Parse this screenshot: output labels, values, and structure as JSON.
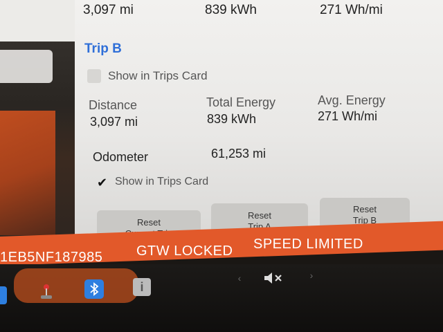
{
  "top_row": {
    "distance": "3,097 mi",
    "energy": "839 kWh",
    "avg": "271 Wh/mi"
  },
  "trip_b": {
    "title": "Trip B",
    "show_in_trips_card": "Show in Trips Card",
    "distance_label": "Distance",
    "distance_value": "3,097 mi",
    "total_energy_label": "Total Energy",
    "total_energy_value": "839 kWh",
    "avg_energy_label": "Avg. Energy",
    "avg_energy_value": "271 Wh/mi"
  },
  "odometer": {
    "label": "Odometer",
    "value": "61,253 mi",
    "show_in_trips_card": "Show in Trips Card",
    "checked": true
  },
  "buttons": {
    "reset_current_line1": "Reset",
    "reset_current_line2": "Current Trip",
    "reset_a_line1": "Reset",
    "reset_a_line2": "Trip A",
    "reset_b_line1": "Reset",
    "reset_b_line2": "Trip B"
  },
  "status_bar": {
    "vin_fragment": "1EB5NF187985",
    "gtw": "GTW LOCKED",
    "speed": "SPEED LIMITED"
  },
  "dock": {
    "icons": [
      "joystick-icon",
      "bluetooth-icon",
      "info-icon",
      "mute-icon"
    ],
    "mute_glyph": "◀×"
  },
  "colors": {
    "accent_blue": "#2f6fd8",
    "status_orange": "#e2592a"
  }
}
